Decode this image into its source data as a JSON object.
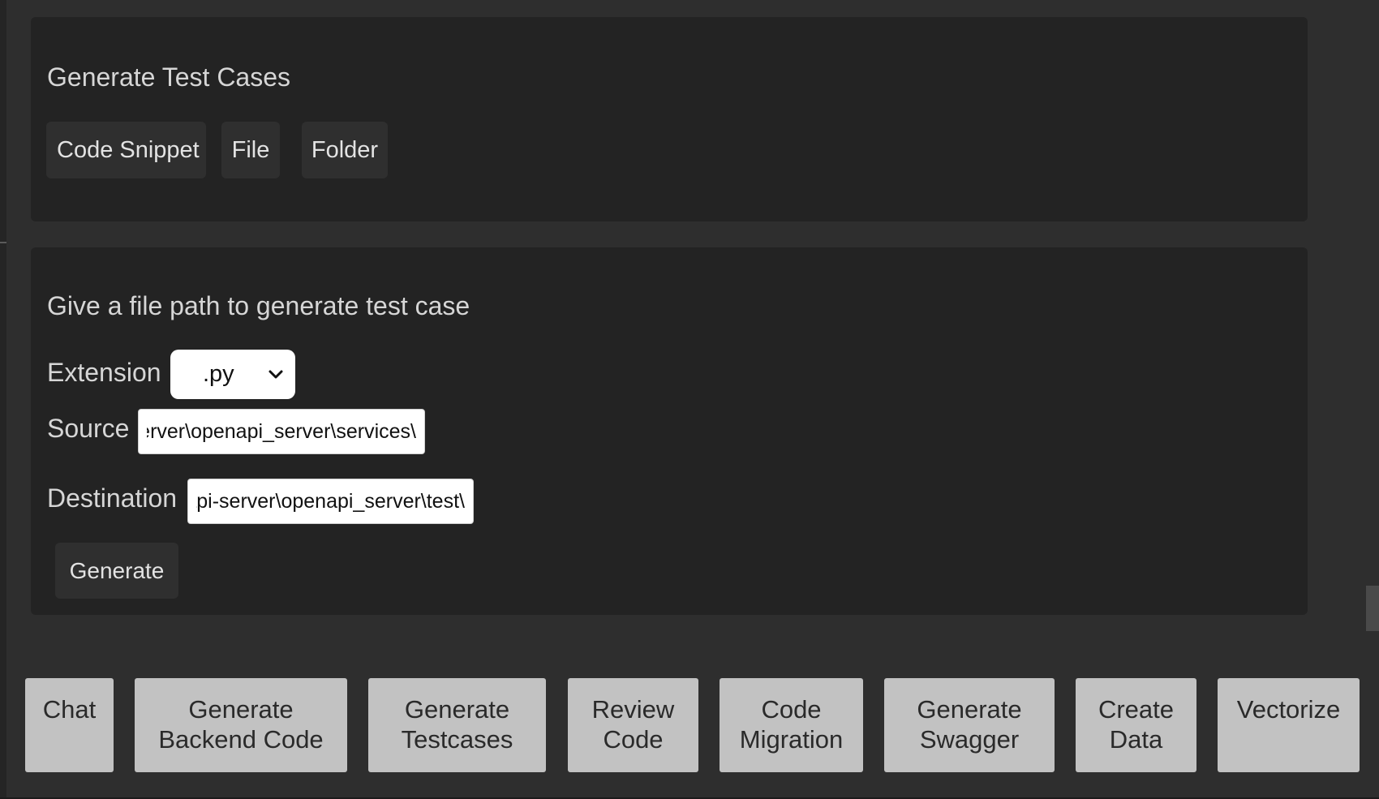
{
  "generate_panel": {
    "title": "Generate Test Cases",
    "options": [
      "Code Snippet",
      "File",
      "Folder"
    ]
  },
  "file_panel": {
    "title": "Give a file path to generate test case",
    "extension_label": "Extension",
    "extension_value": ".py",
    "source_label": "Source",
    "source_value": "\\openapi-server\\openapi_server\\services",
    "destination_label": "Destination",
    "destination_value": "\\openapi-server\\openapi_server\\test",
    "generate_label": "Generate"
  },
  "nav": {
    "chat": "Chat",
    "backend": "Generate\nBackend Code",
    "testcases": "Generate\nTestcases",
    "review": "Review\nCode",
    "migration": "Code\nMigration",
    "swagger": "Generate\nSwagger",
    "create_data": "Create\nData",
    "vectorize": "Vectorize"
  }
}
